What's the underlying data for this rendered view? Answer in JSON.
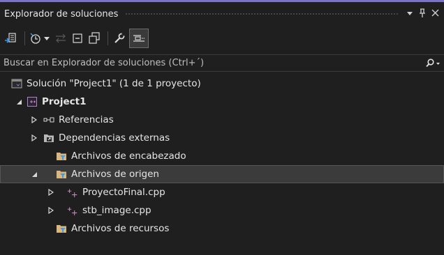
{
  "panel": {
    "title": "Explorador de soluciones",
    "dropdown_glyph": "▾",
    "pin_glyph": "ꟸ",
    "close_glyph": "✕"
  },
  "toolbar": {
    "icons": [
      "sync-with-active-document-icon",
      "history-icon",
      "dropdown-arrow-icon",
      "pending-changes-icon",
      "collapse-all-icon",
      "show-all-files-icon",
      "properties-wrench-icon",
      "preview-selected-items-icon"
    ]
  },
  "search": {
    "placeholder": "Buscar en Explorador de soluciones (Ctrl+´)"
  },
  "tree": {
    "solution": "Solución \"Project1\"  (1 de 1 proyecto)",
    "project": "Project1",
    "items": [
      {
        "label": "Referencias"
      },
      {
        "label": "Dependencias externas"
      },
      {
        "label": "Archivos de encabezado"
      },
      {
        "label": "Archivos de origen"
      },
      {
        "label": "ProyectoFinal.cpp"
      },
      {
        "label": "stb_image.cpp"
      },
      {
        "label": "Archivos de recursos"
      }
    ]
  },
  "colors": {
    "background": "#1f1f1f",
    "accent": "#7b74c4",
    "folder": "#dcb67a",
    "cpp_icon": "#c586c0"
  }
}
